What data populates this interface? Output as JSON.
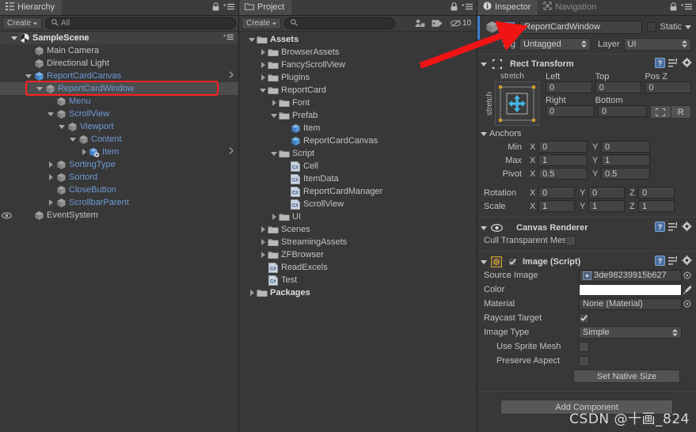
{
  "app": "Unity Editor",
  "watermark": "CSDN @十画_824",
  "colors": {
    "accent_blue": "#3d7fd0",
    "prefab_text": "#6f9ad6",
    "annotation_red": "#ff2020",
    "panel_bg": "#383838",
    "selection": "#4d4d4d"
  },
  "hierarchy": {
    "tab_label": "Hierarchy",
    "tab_icon": "hierarchy-icon",
    "lock_icon": "lock-icon",
    "menu_icon": "panel-menu-icon",
    "create_label": "Create",
    "search_placeholder": "All",
    "search_value": "",
    "search_icon": "search-icon",
    "scene_name": "SampleScene",
    "scene_icon": "unity-scene-icon",
    "items": [
      {
        "label": "Main Camera",
        "depth": 2,
        "arrow": "none",
        "icon": "gameobject-icon",
        "style": "plain",
        "selected": false,
        "eye": false
      },
      {
        "label": "Directional Light",
        "depth": 2,
        "arrow": "none",
        "icon": "gameobject-icon",
        "style": "plain",
        "selected": false,
        "eye": false
      },
      {
        "label": "ReportCardCanvas",
        "depth": 2,
        "arrow": "expanded",
        "icon": "prefab-icon",
        "style": "prefab",
        "selected": false,
        "eye": false,
        "overflow": true
      },
      {
        "label": "ReportCardWindow",
        "depth": 3,
        "arrow": "expanded",
        "icon": "gameobject-icon",
        "style": "prefab",
        "selected": true,
        "eye": false
      },
      {
        "label": "Menu",
        "depth": 4,
        "arrow": "none",
        "icon": "gameobject-icon",
        "style": "prefab",
        "selected": false,
        "eye": false
      },
      {
        "label": "ScrollView",
        "depth": 4,
        "arrow": "expanded",
        "icon": "gameobject-icon",
        "style": "prefab",
        "selected": false,
        "eye": false
      },
      {
        "label": "Viewport",
        "depth": 5,
        "arrow": "expanded",
        "icon": "gameobject-icon",
        "style": "prefab",
        "selected": false,
        "eye": false
      },
      {
        "label": "Content",
        "depth": 6,
        "arrow": "expanded",
        "icon": "gameobject-icon",
        "style": "prefab",
        "selected": false,
        "eye": false
      },
      {
        "label": "Item",
        "depth": 7,
        "arrow": "collapsed",
        "icon": "prefab-variant-icon",
        "style": "prefab",
        "selected": false,
        "eye": false,
        "overflow": true
      },
      {
        "label": "SortingType",
        "depth": 4,
        "arrow": "collapsed",
        "icon": "gameobject-icon",
        "style": "prefab",
        "selected": false,
        "eye": false
      },
      {
        "label": "Sortord",
        "depth": 4,
        "arrow": "collapsed",
        "icon": "gameobject-icon",
        "style": "prefab",
        "selected": false,
        "eye": false
      },
      {
        "label": "CloseButton",
        "depth": 4,
        "arrow": "none",
        "icon": "gameobject-icon",
        "style": "prefab",
        "selected": false,
        "eye": false
      },
      {
        "label": "ScrollbarParent",
        "depth": 4,
        "arrow": "collapsed",
        "icon": "gameobject-icon",
        "style": "prefab",
        "selected": false,
        "eye": false
      },
      {
        "label": "EventSystem",
        "depth": 2,
        "arrow": "none",
        "icon": "gameobject-icon",
        "style": "plain",
        "selected": false,
        "eye": true
      }
    ]
  },
  "project": {
    "tab_label": "Project",
    "tab_icon": "folder-icon",
    "lock_icon": "lock-icon",
    "menu_icon": "panel-menu-icon",
    "create_label": "Create",
    "search_placeholder": "",
    "search_value": "",
    "search_icon": "search-icon",
    "filter_icons": [
      "avatar-filter-icon",
      "label-filter-icon",
      "hidden-packages-icon"
    ],
    "hidden_count": "10",
    "items": [
      {
        "label": "Assets",
        "depth": 0,
        "arrow": "expanded",
        "icon": "folder-icon",
        "bold": true
      },
      {
        "label": "BrowserAssets",
        "depth": 1,
        "arrow": "collapsed",
        "icon": "folder-icon",
        "bold": false
      },
      {
        "label": "FancyScrollView",
        "depth": 1,
        "arrow": "collapsed",
        "icon": "folder-icon",
        "bold": false
      },
      {
        "label": "Plugins",
        "depth": 1,
        "arrow": "collapsed",
        "icon": "folder-icon",
        "bold": false
      },
      {
        "label": "ReportCard",
        "depth": 1,
        "arrow": "expanded",
        "icon": "folder-icon",
        "bold": false
      },
      {
        "label": "Font",
        "depth": 2,
        "arrow": "collapsed",
        "icon": "folder-icon",
        "bold": false
      },
      {
        "label": "Prefab",
        "depth": 2,
        "arrow": "expanded",
        "icon": "folder-icon",
        "bold": false
      },
      {
        "label": "Item",
        "depth": 3,
        "arrow": "none",
        "icon": "prefab-icon",
        "bold": false
      },
      {
        "label": "ReportCardCanvas",
        "depth": 3,
        "arrow": "none",
        "icon": "prefab-icon",
        "bold": false
      },
      {
        "label": "Script",
        "depth": 2,
        "arrow": "expanded",
        "icon": "folder-icon",
        "bold": false
      },
      {
        "label": "Cell",
        "depth": 3,
        "arrow": "none",
        "icon": "csharp-script-icon",
        "bold": false
      },
      {
        "label": "ItemData",
        "depth": 3,
        "arrow": "none",
        "icon": "csharp-script-icon",
        "bold": false
      },
      {
        "label": "ReportCardManager",
        "depth": 3,
        "arrow": "none",
        "icon": "csharp-script-icon",
        "bold": false
      },
      {
        "label": "ScrollView",
        "depth": 3,
        "arrow": "none",
        "icon": "csharp-script-icon",
        "bold": false
      },
      {
        "label": "UI",
        "depth": 2,
        "arrow": "collapsed",
        "icon": "folder-icon",
        "bold": false
      },
      {
        "label": "Scenes",
        "depth": 1,
        "arrow": "collapsed",
        "icon": "folder-icon",
        "bold": false
      },
      {
        "label": "StreamingAssets",
        "depth": 1,
        "arrow": "collapsed",
        "icon": "folder-icon",
        "bold": false
      },
      {
        "label": "ZFBrowser",
        "depth": 1,
        "arrow": "collapsed",
        "icon": "folder-icon",
        "bold": false
      },
      {
        "label": "ReadExcels",
        "depth": 1,
        "arrow": "none",
        "icon": "csharp-script-icon",
        "bold": false
      },
      {
        "label": "Test",
        "depth": 1,
        "arrow": "none",
        "icon": "csharp-script-icon",
        "bold": false
      },
      {
        "label": "Packages",
        "depth": 0,
        "arrow": "collapsed",
        "icon": "folder-icon",
        "bold": true
      }
    ]
  },
  "inspector": {
    "tabs": [
      {
        "label": "Inspector",
        "icon": "info-icon",
        "active": true
      },
      {
        "label": "Navigation",
        "icon": "navigation-icon",
        "active": false
      }
    ],
    "lock_icon": "lock-icon",
    "menu_icon": "panel-menu-icon",
    "gameobject": {
      "icon": "gameobject-icon",
      "active_checked": false,
      "name": "ReportCardWindow",
      "static_label": "Static",
      "static_checked": false,
      "tag_label": "Tag",
      "tag_value": "Untagged",
      "layer_label": "Layer",
      "layer_value": "UI"
    },
    "rect_transform": {
      "title": "Rect Transform",
      "icon": "rect-transform-icon",
      "anchor_preset_top": "stretch",
      "anchor_preset_side": "stretch",
      "fields": {
        "left_label": "Left",
        "left_value": "0",
        "top_label": "Top",
        "top_value": "0",
        "posz_label": "Pos Z",
        "posz_value": "0",
        "right_label": "Right",
        "right_value": "0",
        "bottom_label": "Bottom",
        "bottom_value": "0",
        "blueprint_button": "blueprint-mode-icon",
        "raw_button": "R"
      },
      "anchors_label": "Anchors",
      "min_label": "Min",
      "min_x": "0",
      "min_y": "0",
      "max_label": "Max",
      "max_x": "1",
      "max_y": "1",
      "pivot_label": "Pivot",
      "pivot_x": "0.5",
      "pivot_y": "0.5",
      "rotation_label": "Rotation",
      "rot_x": "0",
      "rot_y": "0",
      "rot_z": "0",
      "scale_label": "Scale",
      "scale_x": "1",
      "scale_y": "1",
      "scale_z": "1"
    },
    "canvas_renderer": {
      "title": "Canvas Renderer",
      "icon": "eye-icon",
      "cull_label": "Cull Transparent Mes",
      "cull_checked": false
    },
    "image_script": {
      "title": "Image (Script)",
      "icon": "script-component-icon",
      "enabled": true,
      "source_image_label": "Source Image",
      "source_image_value": "3de98239915b627",
      "color_label": "Color",
      "color_value": "#FFFFFF",
      "eyedropper_icon": "eyedropper-icon",
      "material_label": "Material",
      "material_value": "None (Material)",
      "raycast_label": "Raycast Target",
      "raycast_checked": true,
      "image_type_label": "Image Type",
      "image_type_value": "Simple",
      "use_sprite_mesh_label": "Use Sprite Mesh",
      "use_sprite_mesh_checked": false,
      "preserve_aspect_label": "Preserve Aspect",
      "preserve_aspect_checked": false,
      "set_native_size_label": "Set Native Size"
    },
    "add_component_label": "Add Component"
  }
}
